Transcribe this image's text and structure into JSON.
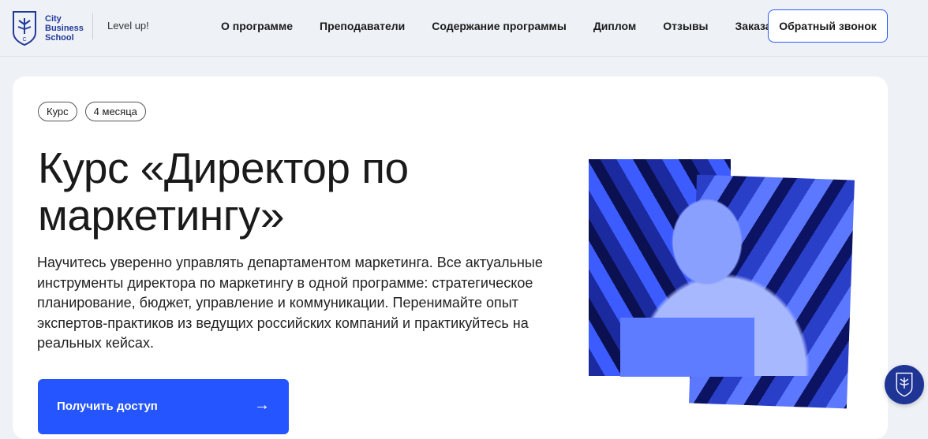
{
  "header": {
    "logo_text": [
      "City",
      "Business",
      "School"
    ],
    "tagline": "Level up!",
    "nav": [
      "О программе",
      "Преподаватели",
      "Содержание программы",
      "Диплом",
      "Отзывы",
      "Заказать"
    ],
    "callback": "Обратный звонок"
  },
  "hero": {
    "tags": [
      "Курс",
      "4 месяца"
    ],
    "title": "Курс «Директор по маркетингу»",
    "description": "Научитесь уверенно управлять департаментом маркетинга. Все актуальные инструменты директора по маркетингу в одной программе: стратегическое планирование, бюджет, управление и коммуникации. Перенимайте опыт экспертов-практиков из ведущих российских компаний и практикуйтесь на реальных кейсах.",
    "cta": "Получить доступ"
  },
  "colors": {
    "brand": "#23399a",
    "accent": "#2555ff"
  }
}
